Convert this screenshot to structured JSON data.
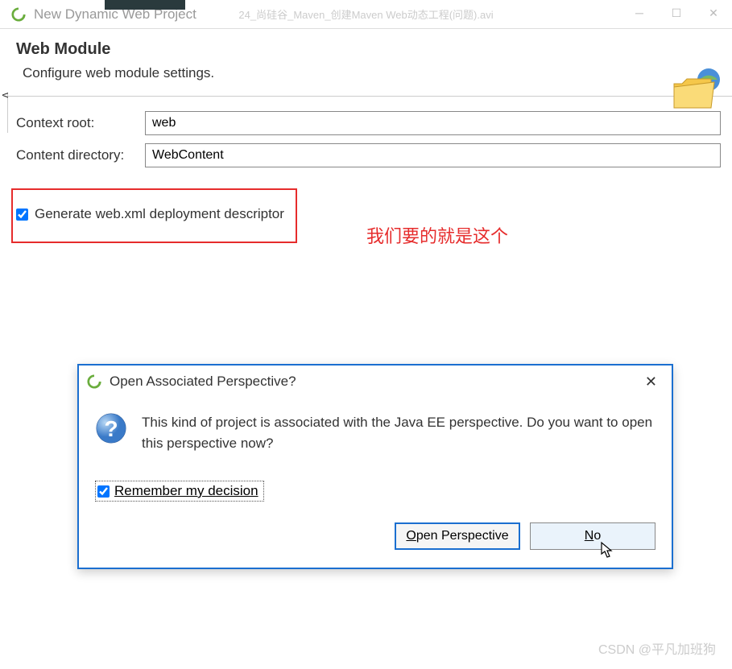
{
  "window": {
    "title": "New Dynamic Web Project",
    "video_caption": "24_尚硅谷_Maven_创建Maven Web动态工程(问题).avi"
  },
  "header": {
    "title": "Web Module",
    "description": "Configure web module settings."
  },
  "form": {
    "context_root_label": "Context root:",
    "context_root_value": "web",
    "content_dir_label": "Content directory:",
    "content_dir_value": "WebContent",
    "generate_label": "Generate web.xml deployment descriptor"
  },
  "annotation": "我们要的就是这个",
  "modal": {
    "title": "Open Associated Perspective?",
    "message": "This kind of project is associated with the Java EE perspective.  Do you want to open this perspective now?",
    "remember_label": "Remember my decision",
    "open_btn": "Open Perspective",
    "no_btn": "No"
  },
  "watermark": "CSDN @平凡加班狗"
}
